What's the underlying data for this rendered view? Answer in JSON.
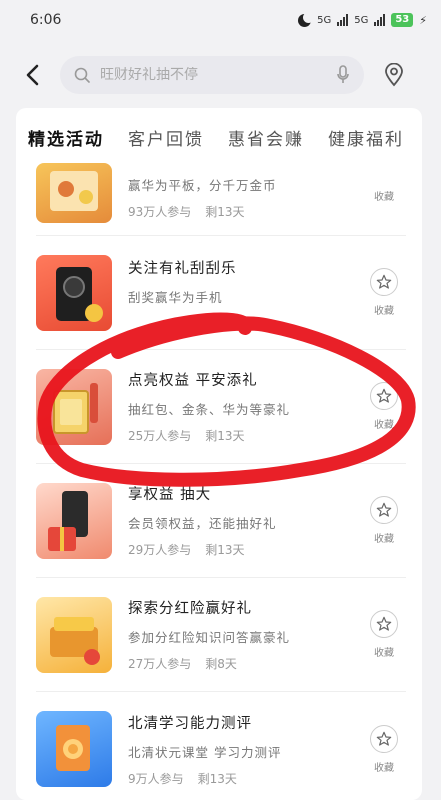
{
  "status_bar": {
    "time": "6:06",
    "network_1": "5G",
    "network_2": "5G",
    "battery": "53"
  },
  "search": {
    "placeholder": "旺财好礼抽不停"
  },
  "tabs": [
    {
      "label": "精选活动",
      "active": true
    },
    {
      "label": "客户回馈",
      "active": false
    },
    {
      "label": "惠省会赚",
      "active": false
    },
    {
      "label": "健康福利",
      "active": false
    }
  ],
  "favorite_label": "收藏",
  "items": [
    {
      "title": "",
      "desc": "赢华为平板，分千万金币",
      "participants": "93万人参与",
      "remaining": "剩13天"
    },
    {
      "title": "关注有礼刮刮乐",
      "desc": "刮奖赢华为手机",
      "participants": "",
      "remaining": ""
    },
    {
      "title": "点亮权益 平安添礼",
      "desc": "抽红包、金条、华为等豪礼",
      "participants": "25万人参与",
      "remaining": "剩13天"
    },
    {
      "title": "享权益 抽大",
      "desc": "会员领权益，还能抽好礼",
      "participants": "29万人参与",
      "remaining": "剩13天"
    },
    {
      "title": "探索分红险赢好礼",
      "desc": "参加分红险知识问答赢豪礼",
      "participants": "27万人参与",
      "remaining": "剩8天"
    },
    {
      "title": "北清学习能力测评",
      "desc": "北清状元课堂 学习力测评",
      "participants": "9万人参与",
      "remaining": "剩13天"
    }
  ],
  "colors": {
    "active_tab": "#111111",
    "annotation": "#e8141c",
    "battery": "#4cc35a"
  }
}
